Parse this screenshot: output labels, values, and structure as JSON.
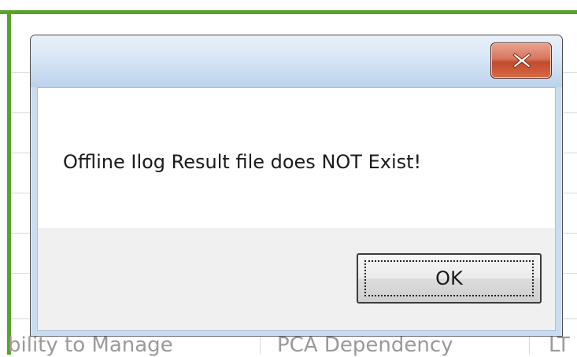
{
  "background_window": {
    "column_headers": [
      "bility to Manage",
      "PCA Dependency",
      "LT"
    ],
    "frame_color": "#5aa02c"
  },
  "dialog": {
    "message": "Offline Ilog Result file does NOT Exist!",
    "ok_label": "OK",
    "close_icon": "close-x-icon",
    "close_color": "#c24b2f"
  }
}
